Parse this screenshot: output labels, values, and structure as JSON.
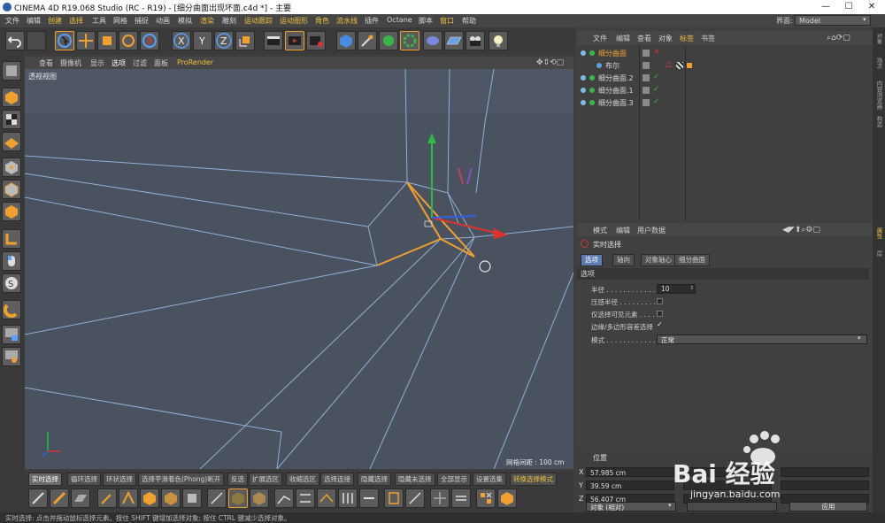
{
  "window": {
    "title": "CINEMA 4D R19.068 Studio (RC - R19) - [细分曲面出现坏面.c4d *] - 主要",
    "minimize": "—",
    "maximize": "☐",
    "close": "✕"
  },
  "menubar": {
    "items": [
      "文件",
      "编辑",
      "创建",
      "选择",
      "工具",
      "网格",
      "捕捉",
      "动画",
      "模拟",
      "渲染",
      "雕刻",
      "运动跟踪",
      "运动图形",
      "角色",
      "流水线",
      "插件",
      "Octane",
      "脚本",
      "窗口",
      "帮助"
    ],
    "layout_label": "界面:",
    "layout_value": "Model"
  },
  "viewport": {
    "menu": [
      "查看",
      "摄像机",
      "显示",
      "选项",
      "过滤",
      "面板",
      "ProRender"
    ],
    "title": "透视视图",
    "grid_label": "网格间距 : 100 cm",
    "colors": {
      "bg": "#4a5260",
      "edges": "#8fb0d8",
      "selected": "#f0a030"
    }
  },
  "bottom_tabs": [
    "实时选择",
    "循环选择",
    "环状选择",
    "选择平滑着色(Phong)断开",
    "反选",
    "扩展选区",
    "收缩选区",
    "选择连接",
    "隐藏选择",
    "隐藏未选择",
    "全部显示",
    "设置选集",
    "转换选择模式"
  ],
  "status": "实时选择: 点击并拖动鼠标选择元素。按住 SHIFT 键增加选择对象; 按住 CTRL 键减少选择对象。",
  "object_manager": {
    "menu": [
      "文件",
      "编辑",
      "查看",
      "对象",
      "标签",
      "书签"
    ],
    "rows": [
      {
        "name": "细分曲面",
        "selected": true
      },
      {
        "name": "布尔",
        "selected": false
      },
      {
        "name": "细分曲面.2",
        "selected": false
      },
      {
        "name": "细分曲面.1",
        "selected": false
      },
      {
        "name": "细分曲面.3",
        "selected": false
      }
    ]
  },
  "attributes": {
    "menu": [
      "模式",
      "编辑",
      "用户数据"
    ],
    "title": "实时选择",
    "tabs": [
      "选项",
      "轴向",
      "对象轴心",
      "细分曲面"
    ],
    "section": "选项",
    "fields": {
      "radius_label": "半径 . . . . . . . . . . . . .",
      "radius_value": "10",
      "pressure_label": "压感半径 . . . . . . . . .",
      "visible_only_label": "仅选择可见元素 . . . .",
      "tolerant_label": "边缘/多边形容差选择",
      "tolerant_check": "✓",
      "mode_label": "模式 . . . . . . . . . . . . .",
      "mode_value": "正常"
    }
  },
  "coordinates": {
    "title": "位置",
    "x": "57.985 cm",
    "y": "39.59 cm",
    "z": "56.407 cm",
    "mode": "对象 (相对)",
    "apply": "应用"
  },
  "right_strip": [
    "对象",
    "场次",
    "内容浏览器",
    "构造",
    "属性",
    "层"
  ],
  "watermark": {
    "text": "Bai 经验",
    "url": "jingyan.baidu.com"
  }
}
